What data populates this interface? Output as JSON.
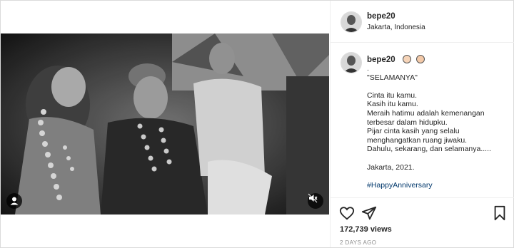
{
  "post": {
    "username": "bepe20",
    "location": "Jakarta, Indonesia",
    "caption_lines": [
      ".",
      "\"SELAMANYA\"",
      "",
      "Cinta itu kamu.",
      "Kasih itu kamu.",
      "Meraih hatimu adalah kemenangan",
      "terbesar dalam hidupku.",
      "Pijar cinta kasih yang selalu",
      "menghangatkan ruang jiwaku.",
      "Dahulu, sekarang, dan selamanya.....",
      "",
      "Jakarta, 2021.",
      ""
    ],
    "hashtag": "#HappyAnniversary",
    "views": "172,739 views",
    "time_ago": "2 DAYS AGO"
  },
  "icons": {
    "video_left_control": "person-tag-icon",
    "mute": "mute-icon",
    "like": "heart-icon",
    "share": "send-icon",
    "save": "bookmark-icon"
  },
  "colors": {
    "border": "#dbdbdb",
    "text": "#262626",
    "muted": "#8e8e8e",
    "hashtag": "#00376b"
  }
}
